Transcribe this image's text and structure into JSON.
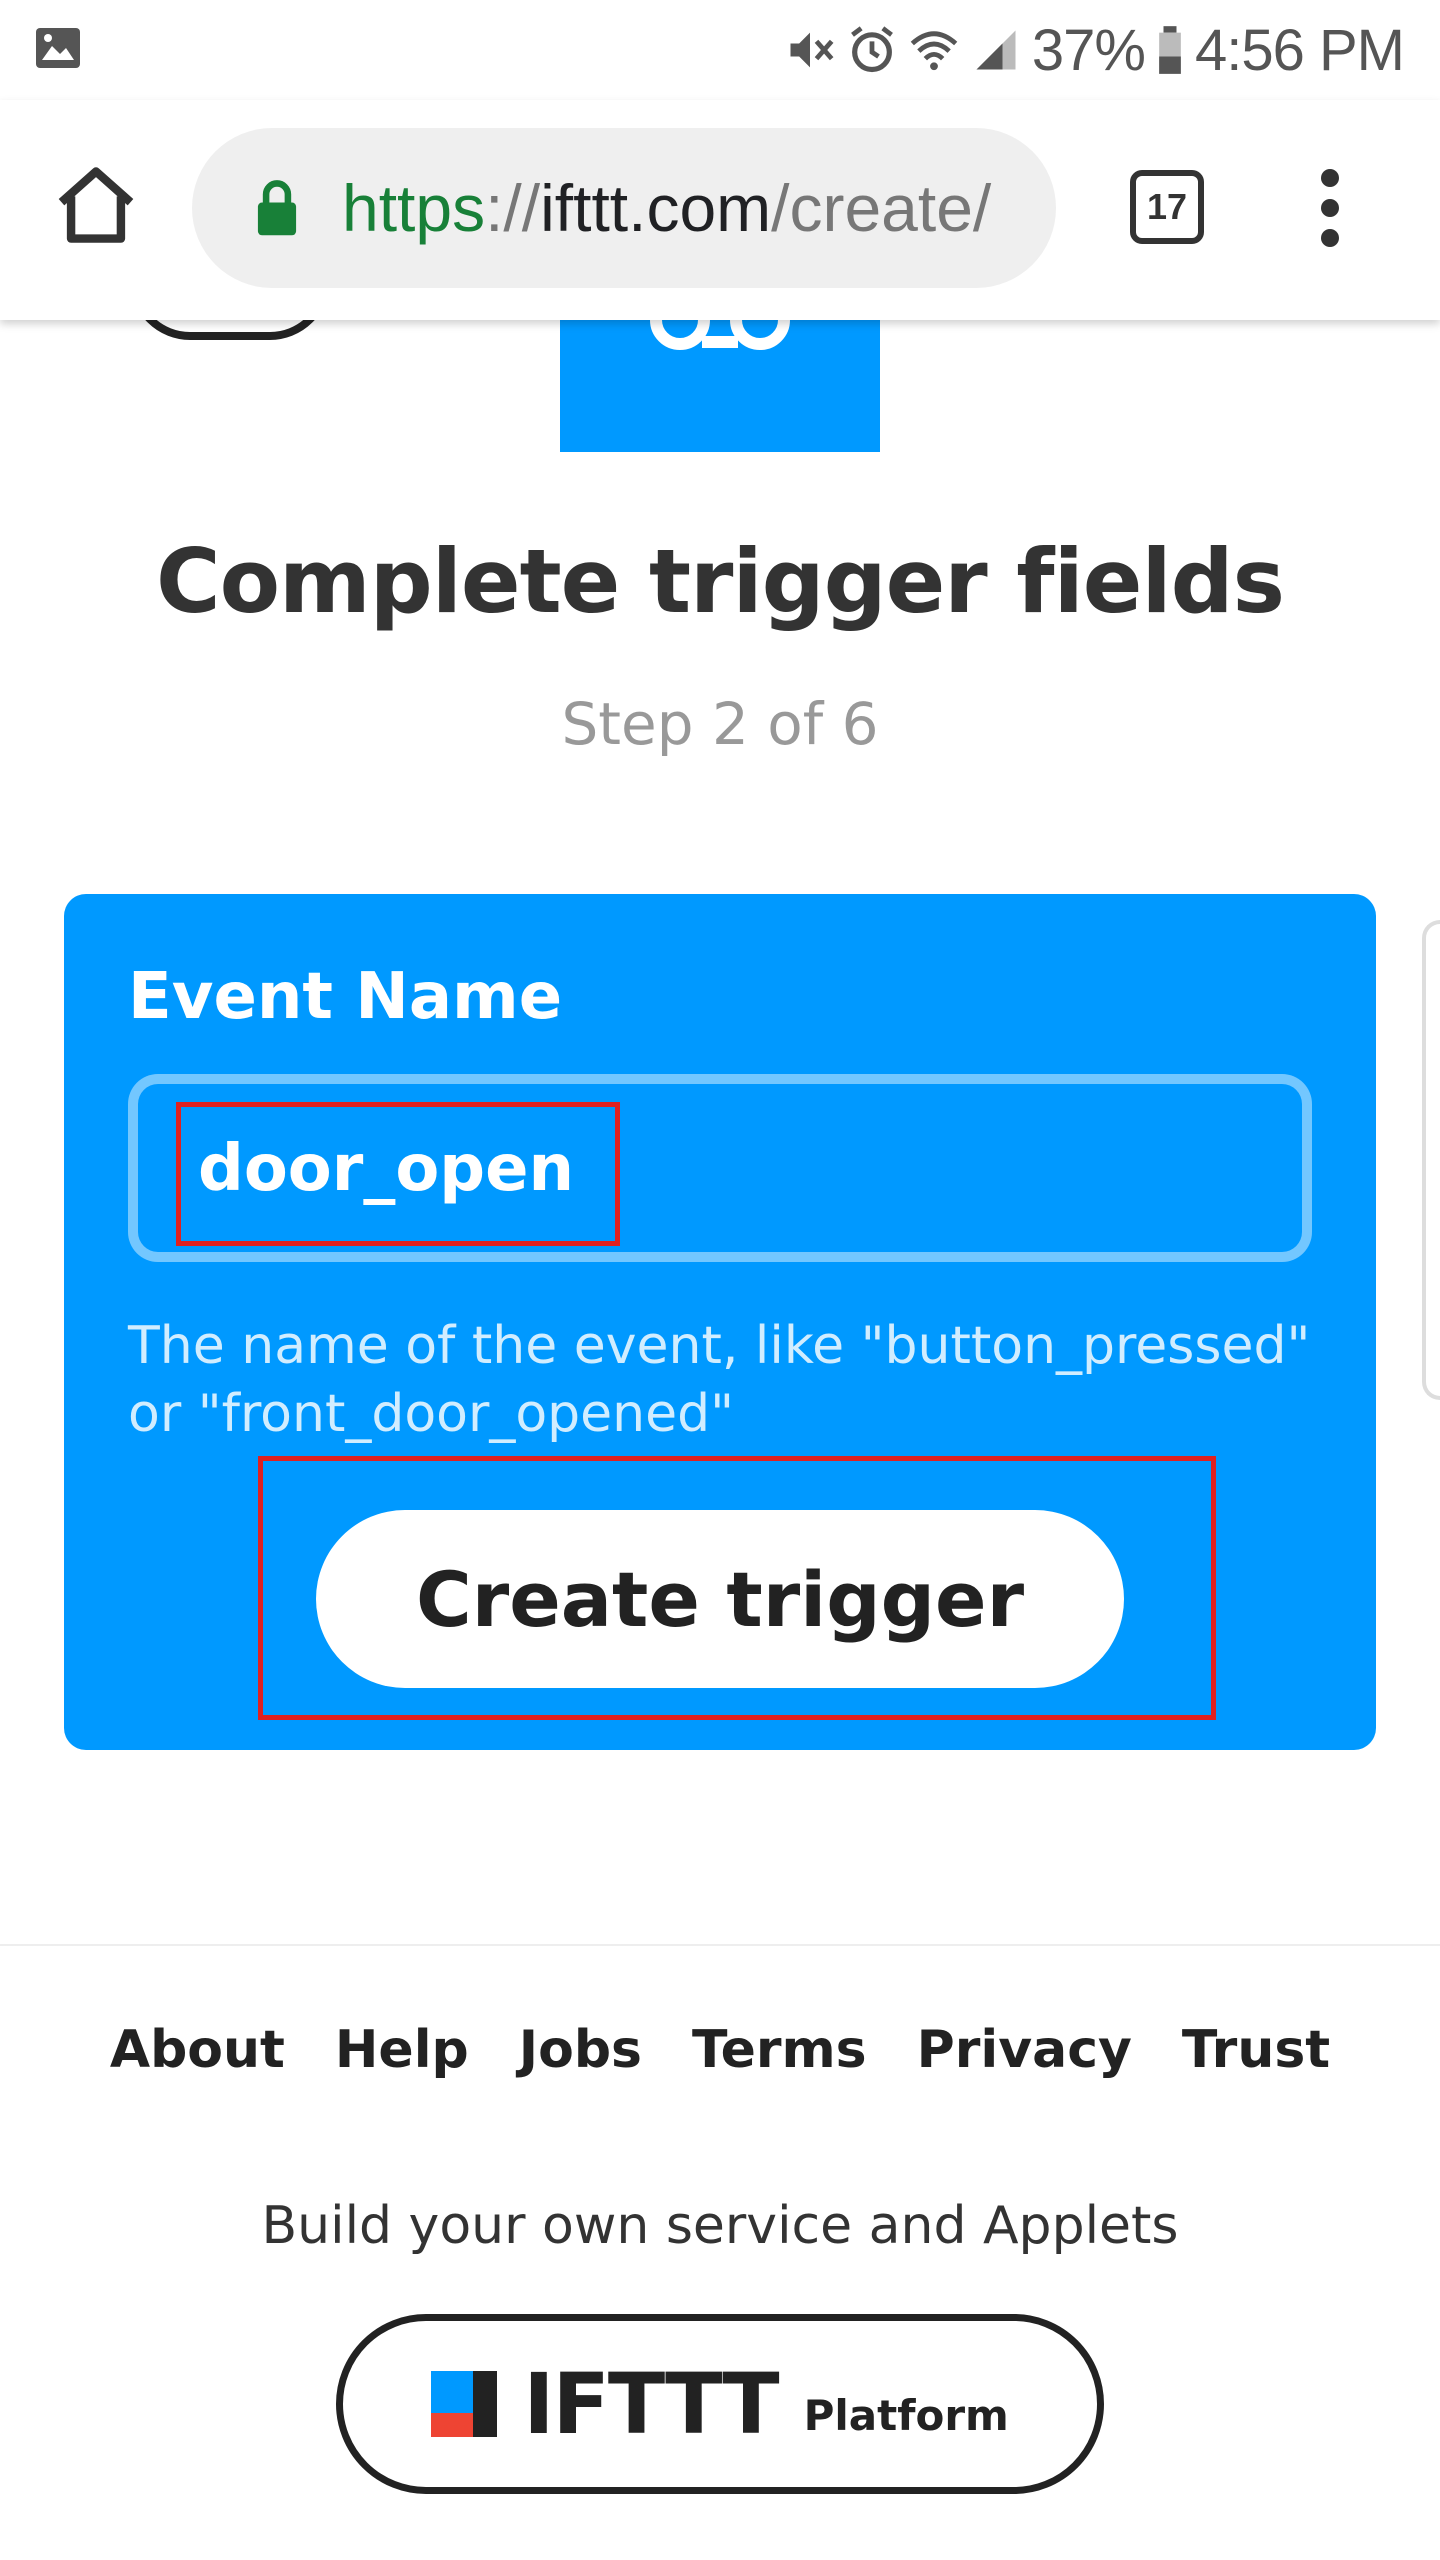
{
  "status_bar": {
    "battery": "37%",
    "time": "4:56 PM",
    "icons": [
      "gallery-icon",
      "mute-icon",
      "alarm-icon",
      "wifi-icon",
      "signal-icon",
      "battery-icon"
    ]
  },
  "browser": {
    "url_scheme": "https",
    "url_separator": "://",
    "url_host": "ifttt.com",
    "url_path": "/create/",
    "tab_count": "17",
    "icons": [
      "home-icon",
      "lock-icon",
      "tabs-icon",
      "more-vert-icon"
    ],
    "accent_secure": "#188038"
  },
  "page": {
    "title": "Complete trigger fields",
    "step": "Step 2 of 6",
    "brand_color": "#0099ff"
  },
  "trigger_form": {
    "field_label": "Event Name",
    "field_value": "door_open",
    "help_text": "The name of the event, like \"button_pressed\" or \"front_door_opened\"",
    "submit_label": "Create trigger"
  },
  "footer": {
    "links": [
      "About",
      "Help",
      "Jobs",
      "Terms",
      "Privacy",
      "Trust"
    ],
    "tagline": "Build your own service and Applets",
    "platform_brand": "IFTTT",
    "platform_word": "Platform"
  }
}
